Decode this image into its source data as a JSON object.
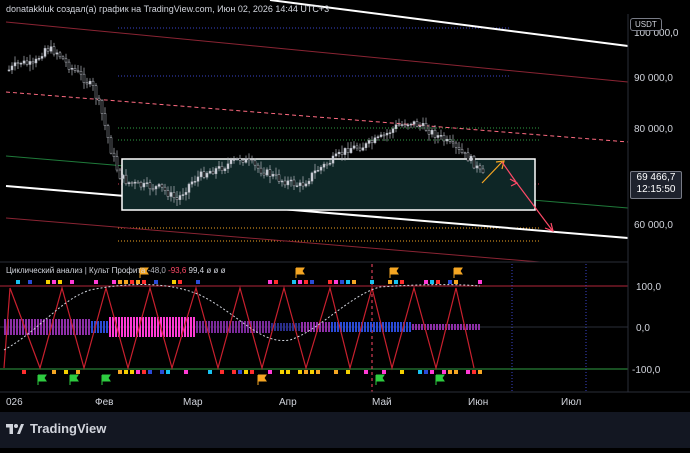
{
  "header": {
    "caption": "donatakkluk создал(а) график на TradingView.com, Июн 02, 2026 14:44 UTC+3"
  },
  "currency": "USDT",
  "price_scale": {
    "labels": [
      "100 000,0",
      "90 000,0",
      "80 000,0",
      "60 000,0"
    ]
  },
  "last_price": {
    "value": "69 466,7",
    "countdown": "12:15:50"
  },
  "indicator": {
    "title": "Циклический анализ | Культ Профита",
    "values": [
      "-48,0",
      "-93,6",
      "99,4",
      "ø",
      "ø",
      "ø"
    ],
    "scale": [
      "100,0",
      "0,0",
      "-100,0"
    ]
  },
  "time_axis": [
    "026",
    "Фев",
    "Мар",
    "Апр",
    "Май",
    "Июн",
    "Июл"
  ],
  "footer": {
    "brand": "TradingView"
  },
  "colors": {
    "background": "#000000",
    "axis_text": "#d1d4dc",
    "red_line": "#b2263a",
    "white_line": "#ffffff",
    "box_fill": "#0f2a2a"
  }
}
